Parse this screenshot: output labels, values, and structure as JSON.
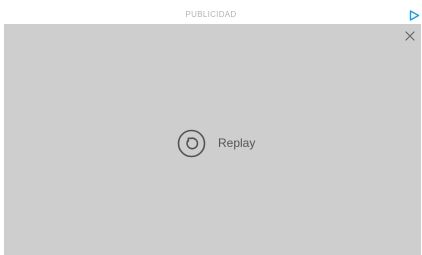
{
  "ad": {
    "label": "PUBLICIDAD",
    "adchoices_icon": "adchoices-icon",
    "close_icon": "close-icon",
    "background_color": "#cecece",
    "accent_color": "#1a9fe0"
  },
  "replay": {
    "icon": "replay-icon",
    "label": "Replay"
  }
}
